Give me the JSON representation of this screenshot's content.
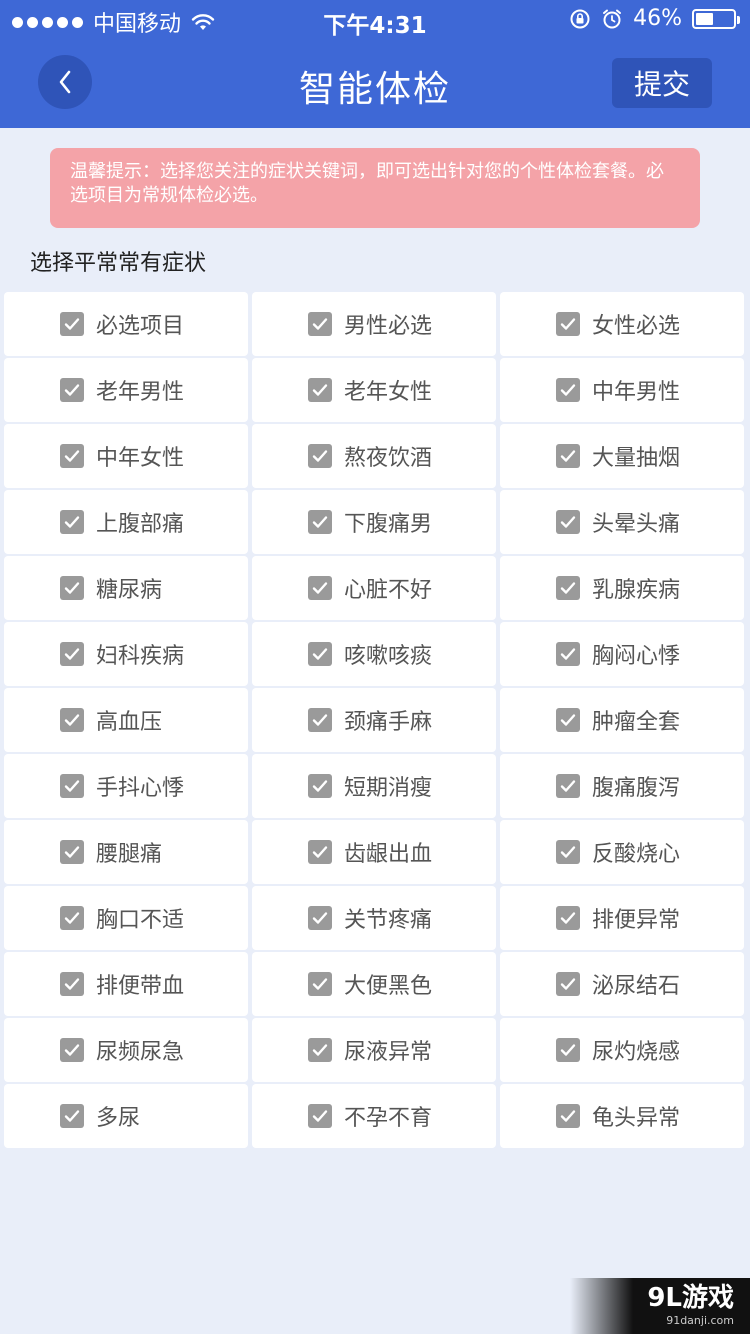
{
  "status": {
    "carrier": "中国移动",
    "time": "下午4:31",
    "battery_percent": "46%",
    "battery_level": 0.46
  },
  "nav": {
    "title": "智能体检",
    "submit_label": "提交"
  },
  "tip": {
    "text": "温馨提示：选择您关注的症状关键词，即可选出针对您的个性体检套餐。必选项目为常规体检必选。"
  },
  "section": {
    "title": "选择平常常有症状"
  },
  "items": [
    {
      "label": "必选项目",
      "checked": true
    },
    {
      "label": "男性必选",
      "checked": true
    },
    {
      "label": "女性必选",
      "checked": true
    },
    {
      "label": "老年男性",
      "checked": true
    },
    {
      "label": "老年女性",
      "checked": true
    },
    {
      "label": "中年男性",
      "checked": true
    },
    {
      "label": "中年女性",
      "checked": true
    },
    {
      "label": "熬夜饮酒",
      "checked": true
    },
    {
      "label": "大量抽烟",
      "checked": true
    },
    {
      "label": "上腹部痛",
      "checked": true
    },
    {
      "label": "下腹痛男",
      "checked": true
    },
    {
      "label": "头晕头痛",
      "checked": true
    },
    {
      "label": "糖尿病",
      "checked": true
    },
    {
      "label": "心脏不好",
      "checked": true
    },
    {
      "label": "乳腺疾病",
      "checked": true
    },
    {
      "label": "妇科疾病",
      "checked": true
    },
    {
      "label": "咳嗽咳痰",
      "checked": true
    },
    {
      "label": "胸闷心悸",
      "checked": true
    },
    {
      "label": "高血压",
      "checked": true
    },
    {
      "label": "颈痛手麻",
      "checked": true
    },
    {
      "label": "肿瘤全套",
      "checked": true
    },
    {
      "label": "手抖心悸",
      "checked": true
    },
    {
      "label": "短期消瘦",
      "checked": true
    },
    {
      "label": "腹痛腹泻",
      "checked": true
    },
    {
      "label": "腰腿痛",
      "checked": true
    },
    {
      "label": "齿龈出血",
      "checked": true
    },
    {
      "label": "反酸烧心",
      "checked": true
    },
    {
      "label": "胸口不适",
      "checked": true
    },
    {
      "label": "关节疼痛",
      "checked": true
    },
    {
      "label": "排便异常",
      "checked": true
    },
    {
      "label": "排便带血",
      "checked": true
    },
    {
      "label": "大便黑色",
      "checked": true
    },
    {
      "label": "泌尿结石",
      "checked": true
    },
    {
      "label": "尿频尿急",
      "checked": true
    },
    {
      "label": "尿液异常",
      "checked": true
    },
    {
      "label": "尿灼烧感",
      "checked": true
    },
    {
      "label": "多尿",
      "checked": true
    },
    {
      "label": "不孕不育",
      "checked": true
    },
    {
      "label": "龟头异常",
      "checked": true
    }
  ],
  "watermark": {
    "brand": "9L游戏",
    "url": "91danji.com"
  },
  "colors": {
    "primary": "#3e68d6",
    "primary_dark": "#2f54b8",
    "tip_bg": "#f4a3a8",
    "page_bg": "#e9eef9",
    "checkbox": "#9a9a9a"
  }
}
